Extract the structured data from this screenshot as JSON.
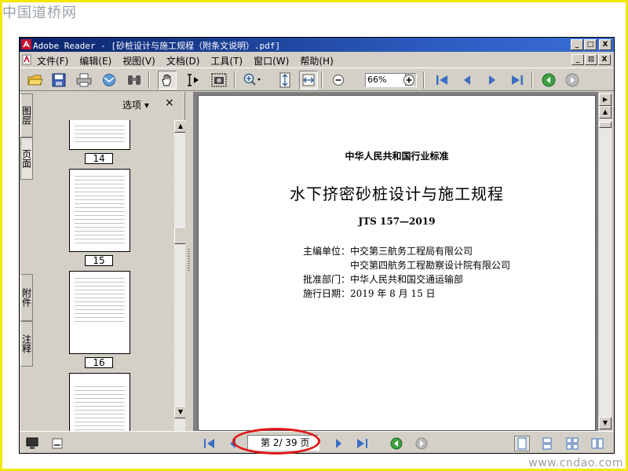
{
  "watermarks": {
    "top": "中国道桥网",
    "bottom": "www.cndao.com"
  },
  "window": {
    "title": "Adobe Reader - [砂桩设计与施工规程（附条文说明）.pdf]",
    "buttons": {
      "minimize": "_",
      "maximize": "□",
      "close": "X",
      "restore": "⊡"
    }
  },
  "menubar": {
    "items": [
      "文件(F)",
      "编辑(E)",
      "视图(V)",
      "文档(D)",
      "工具(T)",
      "窗口(W)",
      "帮助(H)"
    ]
  },
  "toolbar": {
    "icons": [
      "open-icon",
      "save-icon",
      "print-icon",
      "email-icon",
      "search-icon",
      "hand-tool-icon",
      "select-text-icon",
      "snapshot-icon",
      "zoom-in-tool-icon",
      "fit-page-icon",
      "fit-width-icon",
      "zoom-out-icon",
      "zoom-plus-icon",
      "first-page-icon",
      "prev-page-icon",
      "next-page-icon",
      "last-page-icon",
      "go-back-icon",
      "go-forward-icon"
    ],
    "zoom_value": "66%"
  },
  "nav_tabs": [
    "图层",
    "页面",
    "附件",
    "注释"
  ],
  "thumbnails": {
    "options_label": "选项 ▾",
    "close": "×",
    "pages": [
      "14",
      "15",
      "16"
    ]
  },
  "document": {
    "standard_line": "中华人民共和国行业标准",
    "title": "水下挤密砂桩设计与施工规程",
    "code": "JTS 157—2019",
    "chief_label": "主编单位：",
    "chief_1": "中交第三航务工程局有限公司",
    "chief_2": "中交第四航务工程勘察设计院有限公司",
    "approve_label": "批准部门：",
    "approve_value": "中华人民共和国交通运输部",
    "effective_label": "施行日期：",
    "effective_value": "2019 年 8 月 15 日"
  },
  "statusbar": {
    "page_indicator": "第 2/ 39 页"
  },
  "colors": {
    "title_bar": "#0a246a",
    "highlight_circle": "#e01818",
    "frame": "#f3e600"
  }
}
